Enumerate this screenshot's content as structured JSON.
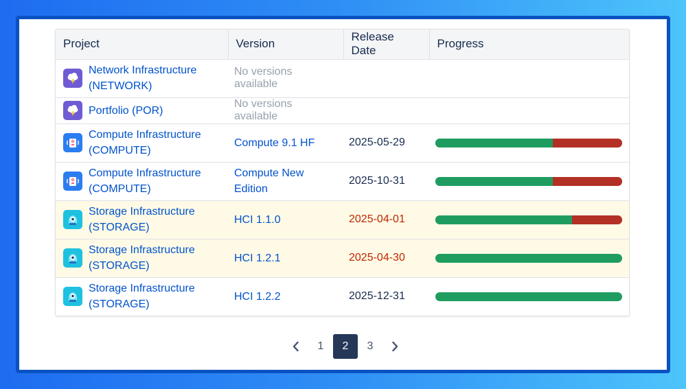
{
  "table": {
    "headers": [
      "Project",
      "Version",
      "Release Date",
      "Progress"
    ],
    "rows": [
      {
        "project": "Network Infrastructure (NETWORK)",
        "icon": "cloud-lightning-icon",
        "version": "No versions available",
        "version_available": false,
        "date": "",
        "overdue": false,
        "progress": null,
        "highlight": false
      },
      {
        "project": "Portfolio (POR)",
        "icon": "cloud-lightning-icon",
        "version": "No versions available",
        "version_available": false,
        "date": "",
        "overdue": false,
        "progress": null,
        "highlight": false
      },
      {
        "project": "Compute Infrastructure (COMPUTE)",
        "icon": "robot-icon",
        "version": "Compute 9.1 HF",
        "version_available": true,
        "date": "2025-05-29",
        "overdue": false,
        "progress": 0.63,
        "highlight": false
      },
      {
        "project": "Compute Infrastructure (COMPUTE)",
        "icon": "robot-icon",
        "version": "Compute New Edition",
        "version_available": true,
        "date": "2025-10-31",
        "overdue": false,
        "progress": 0.63,
        "highlight": false
      },
      {
        "project": "Storage Infrastructure (STORAGE)",
        "icon": "cyclops-icon",
        "version": "HCI 1.1.0",
        "version_available": true,
        "date": "2025-04-01",
        "overdue": true,
        "progress": 0.73,
        "highlight": true
      },
      {
        "project": "Storage Infrastructure (STORAGE)",
        "icon": "cyclops-icon",
        "version": "HCI 1.2.1",
        "version_available": true,
        "date": "2025-04-30",
        "overdue": true,
        "progress": 1.0,
        "highlight": true
      },
      {
        "project": "Storage Infrastructure (STORAGE)",
        "icon": "cyclops-icon",
        "version": "HCI 1.2.2",
        "version_available": true,
        "date": "2025-12-31",
        "overdue": false,
        "progress": 1.0,
        "highlight": false
      }
    ]
  },
  "pagination": {
    "prev_icon": "chevron-left-icon",
    "next_icon": "chevron-right-icon",
    "pages": [
      "1",
      "2",
      "3"
    ],
    "current": "2"
  },
  "colors": {
    "link": "#0052cc",
    "overdue": "#bf2600",
    "progress_done": "#1f9d60",
    "progress_todo": "#b33025",
    "highlight_row": "#fffae6",
    "active_page": "#253858"
  }
}
